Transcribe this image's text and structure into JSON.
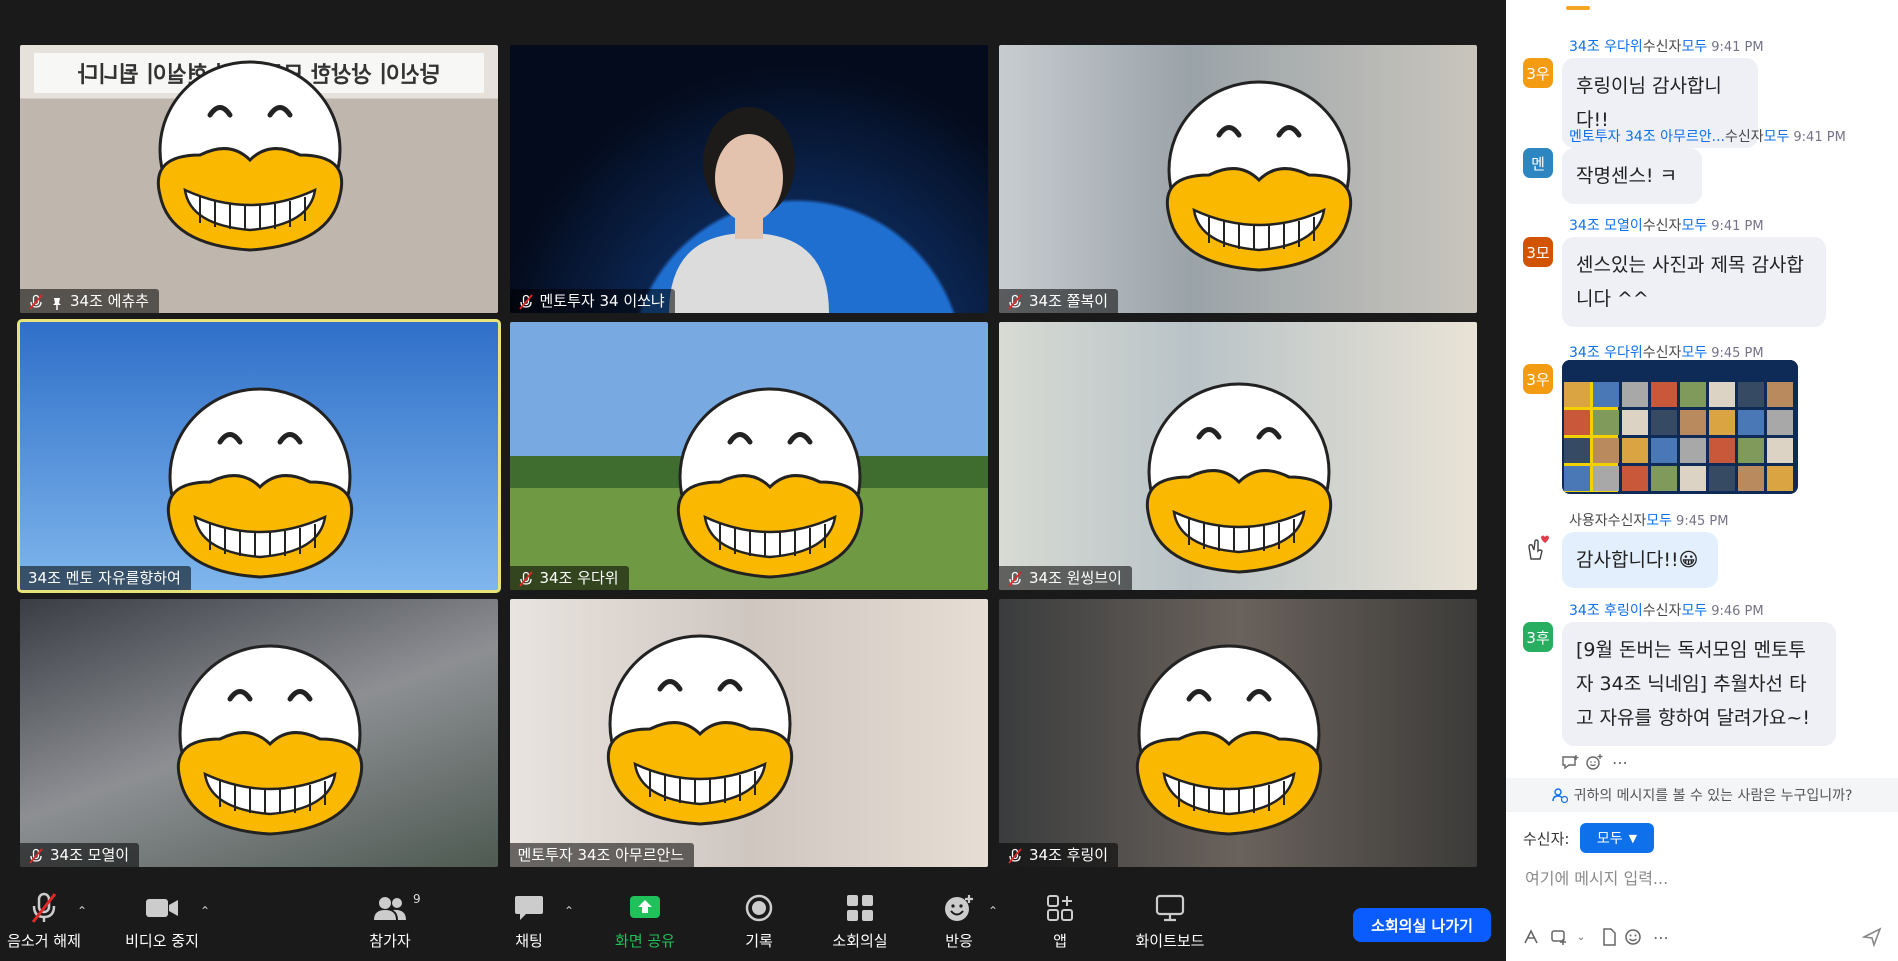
{
  "tiles": [
    {
      "name": "34조 에츄추",
      "muted": true,
      "pinned": true
    },
    {
      "name": "멘토투자 34 이쏘냐",
      "muted": true,
      "pinned": false
    },
    {
      "name": "34조 쫄복이",
      "muted": true,
      "pinned": false
    },
    {
      "name": "34조 멘토 자유를향하여",
      "muted": false,
      "pinned": false,
      "active": true
    },
    {
      "name": "34조 우다위",
      "muted": true,
      "pinned": false
    },
    {
      "name": "34조 원씽브이",
      "muted": true,
      "pinned": false
    },
    {
      "name": "34조 모열이",
      "muted": true,
      "pinned": false
    },
    {
      "name": "멘토투자 34조 아무르안느",
      "muted": false,
      "pinned": false
    },
    {
      "name": "34조 후링이",
      "muted": true,
      "pinned": false
    }
  ],
  "banner_text": "당신이 상상한 모든 것이 현실이 됩니다",
  "toolbar": {
    "unmute": "음소거 해제",
    "stop_video": "비디오 중지",
    "participants": "참가자",
    "participants_count": "9",
    "chat": "채팅",
    "share": "화면 공유",
    "record": "기록",
    "breakout": "소회의실",
    "reactions": "반응",
    "apps": "앱",
    "whiteboard": "화이트보드",
    "leave": "소회의실 나가기"
  },
  "chat": {
    "to_word": "수신자",
    "all_word": "모두",
    "messages": [
      {
        "from": "34조 우다위",
        "time": "9:41 PM",
        "avatar": "3우",
        "avatar_color": "#f39c12",
        "text": "후링이님 감사합니다!!"
      },
      {
        "from": "멘토투자 34조 아무르안...",
        "time": "9:41 PM",
        "avatar": "멘",
        "avatar_color": "#2e86c1",
        "text": "작명센스! ㅋ"
      },
      {
        "from": "34조 모열이",
        "time": "9:41 PM",
        "avatar": "3모",
        "avatar_color": "#d35400",
        "text": "센스있는 사진과 제목 감사합니다 ^^"
      },
      {
        "from": "34조 우다위",
        "time": "9:45 PM",
        "avatar": "3우",
        "avatar_color": "#f39c12",
        "image": true
      },
      {
        "from": "사용자",
        "time": "9:45 PM",
        "avatar": "heart",
        "avatar_color": "#ffffff",
        "text": "감사합니다!!😀"
      },
      {
        "from": "34조 후링이",
        "time": "9:46 PM",
        "avatar": "3후",
        "avatar_color": "#27ae60",
        "text": "[9월 돈버는 독서모임 멘토투자 34조 닉네임] 추월차선 타고 자유를 향하여 달려가요~!"
      }
    ],
    "who_can_see": "귀하의 메시지를 볼 수 있는 사람은 누구입니까?",
    "recipient_label": "수신자:",
    "recipient_value": "모두",
    "input_placeholder": "여기에 메시지 입력..."
  },
  "colors": {
    "zoom_blue": "#0b5cff",
    "share_green": "#20c05a",
    "active_speaker": "#e8e27a",
    "mask_yellow": "#fbb800"
  }
}
